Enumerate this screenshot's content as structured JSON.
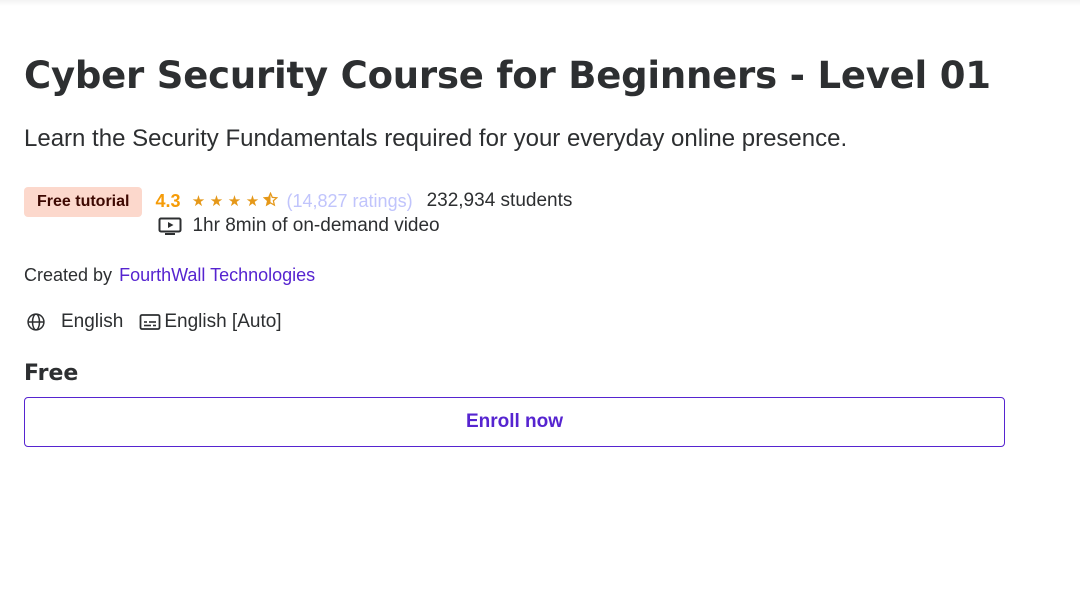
{
  "course": {
    "title": "Cyber Security Course for Beginners - Level 01",
    "subtitle": "Learn the Security Fundamentals required for your everyday online presence.",
    "badge": "Free tutorial",
    "rating": "4.3",
    "rating_value": 4.3,
    "rating_max": 5,
    "ratings_count": "(14,827 ratings)",
    "students": "232,934 students",
    "duration": "1hr 8min of on-demand video",
    "created_by_label": "Created by",
    "author": "FourthWall Technologies",
    "language": "English",
    "captions": "English [Auto]",
    "price": "Free",
    "enroll_label": "Enroll now"
  },
  "icons": {
    "video": "video-icon",
    "globe": "globe-icon",
    "captions": "closed-captions-icon",
    "star": "star-icon"
  },
  "colors": {
    "accent": "#5624d0",
    "badge_bg": "#fcd8cc",
    "badge_text": "#3d0801",
    "rating": "#f69c08",
    "ratings_link": "#c0c4fc"
  }
}
